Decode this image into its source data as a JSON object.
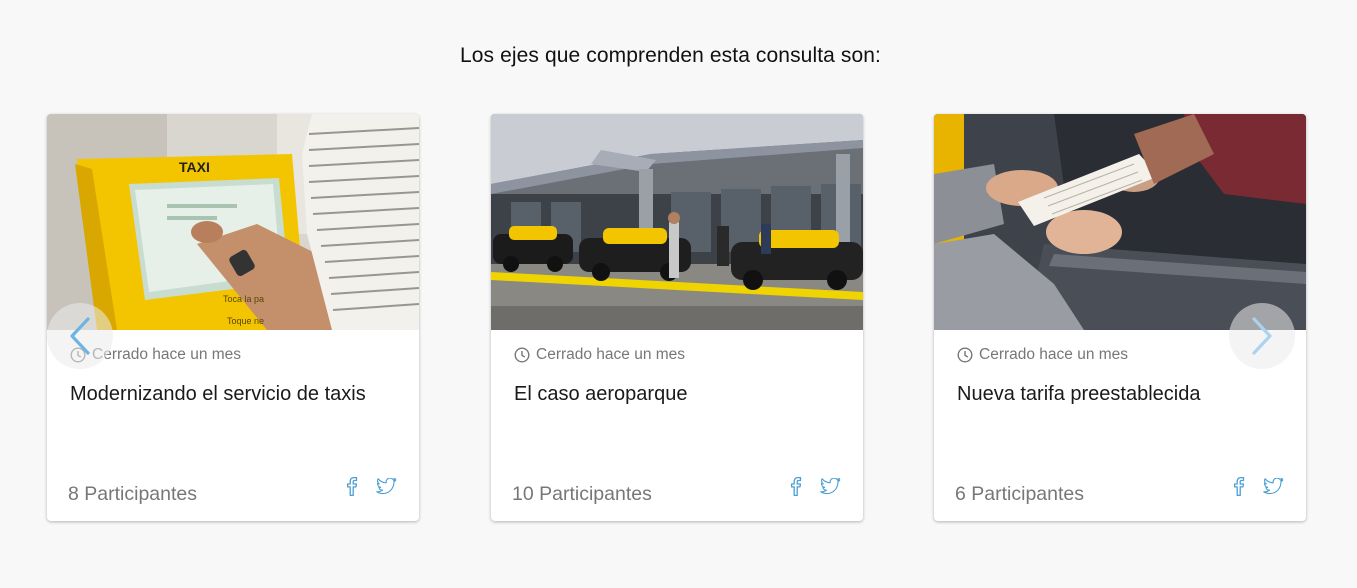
{
  "section": {
    "title": "Los ejes que comprenden esta consulta son:"
  },
  "cards": [
    {
      "status": "Cerrado hace un mes",
      "title": "Modernizando el servicio de taxis",
      "participants": "8 Participantes",
      "image_text": {
        "sign": "TAXI",
        "caption1": "Toca la pa",
        "caption2": "Toque ne"
      }
    },
    {
      "status": "Cerrado hace un mes",
      "title": "El caso aeroparque",
      "participants": "10 Participantes"
    },
    {
      "status": "Cerrado hace un mes",
      "title": "Nueva tarifa preestablecida",
      "participants": "6 Participantes"
    }
  ],
  "icons": {
    "status": "clock-icon",
    "share_facebook": "facebook-icon",
    "share_twitter": "twitter-icon",
    "prev": "chevron-left-icon",
    "next": "chevron-right-icon"
  },
  "colors": {
    "background": "#f8f8f8",
    "accent": "#4a9fd4",
    "muted_text": "#777777",
    "taxi_yellow": "#f2c500"
  }
}
